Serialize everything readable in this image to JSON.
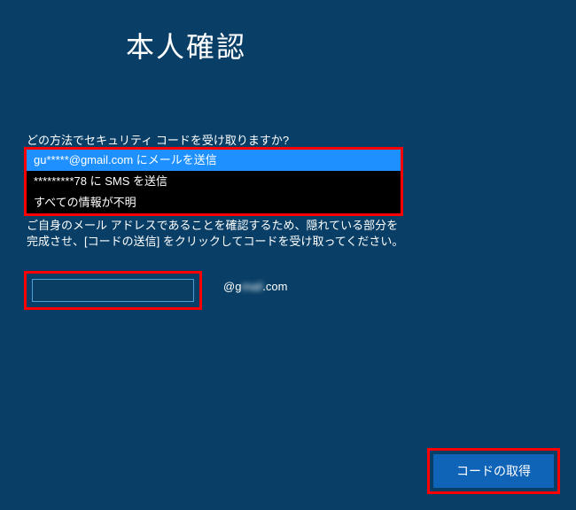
{
  "title": "本人確認",
  "prompt": "どの方法でセキュリティ コードを受け取りますか?",
  "options": [
    {
      "label": "gu*****@gmail.com にメールを送信",
      "selected": true
    },
    {
      "label": "*********78 に SMS を送信",
      "selected": false
    },
    {
      "label": "すべての情報が不明",
      "selected": false
    }
  ],
  "instructions": "ご自身のメール アドレスであることを確認するため、隠れている部分を完成させ、[コードの送信] をクリックしてコードを受け取ってください。",
  "input": {
    "value": ""
  },
  "domain_at": "@g",
  "domain_blur": "mail",
  "domain_suffix": ".com",
  "submit_label": "コードの取得"
}
